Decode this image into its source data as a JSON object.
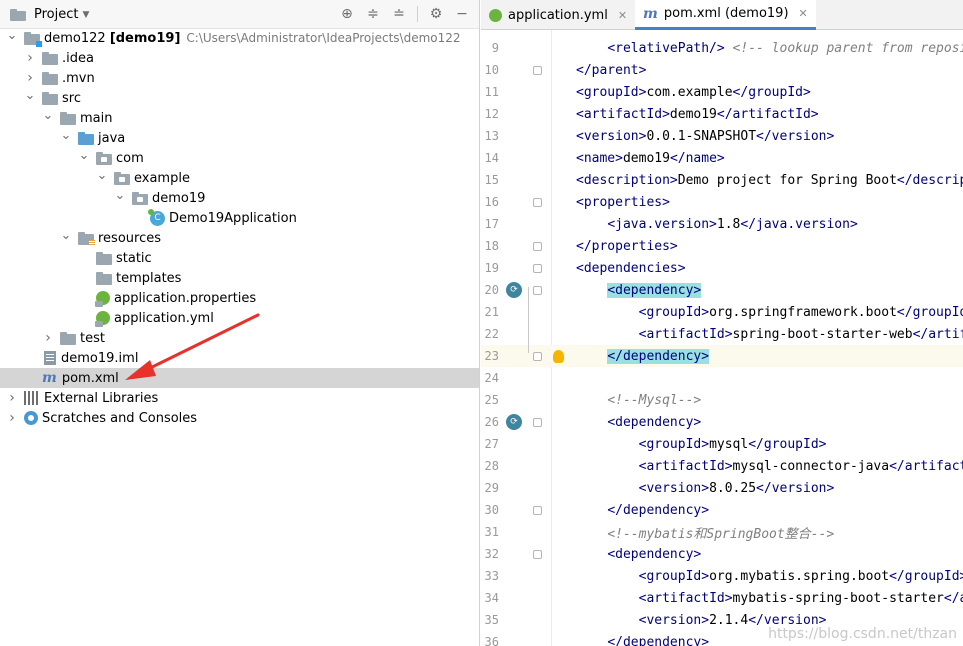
{
  "project_panel": {
    "title": "Project",
    "header_icons": [
      "crosshair-icon",
      "expand-all-icon",
      "collapse-all-icon",
      "gear-icon",
      "minimize-icon"
    ],
    "tree": [
      {
        "label": "demo122 [demo19]",
        "path": "C:\\Users\\Administrator\\IdeaProjects\\demo122",
        "indent": 0,
        "expanded": true,
        "icon": "module-folder"
      },
      {
        "label": ".idea",
        "indent": 1,
        "expanded": false,
        "icon": "folder"
      },
      {
        "label": ".mvn",
        "indent": 1,
        "expanded": false,
        "icon": "folder"
      },
      {
        "label": "src",
        "indent": 1,
        "expanded": true,
        "icon": "folder"
      },
      {
        "label": "main",
        "indent": 2,
        "expanded": true,
        "icon": "folder"
      },
      {
        "label": "java",
        "indent": 3,
        "expanded": true,
        "icon": "source-folder"
      },
      {
        "label": "com",
        "indent": 4,
        "expanded": true,
        "icon": "package"
      },
      {
        "label": "example",
        "indent": 5,
        "expanded": true,
        "icon": "package"
      },
      {
        "label": "demo19",
        "indent": 6,
        "expanded": true,
        "icon": "package"
      },
      {
        "label": "Demo19Application",
        "indent": 7,
        "icon": "class"
      },
      {
        "label": "resources",
        "indent": 3,
        "expanded": true,
        "icon": "resources-folder"
      },
      {
        "label": "static",
        "indent": 4,
        "icon": "folder"
      },
      {
        "label": "templates",
        "indent": 4,
        "icon": "folder"
      },
      {
        "label": "application.properties",
        "indent": 4,
        "icon": "spring-config"
      },
      {
        "label": "application.yml",
        "indent": 4,
        "icon": "spring-config"
      },
      {
        "label": "test",
        "indent": 2,
        "expanded": false,
        "icon": "folder"
      },
      {
        "label": "demo19.iml",
        "indent": 1,
        "icon": "iml-file"
      },
      {
        "label": "pom.xml",
        "indent": 1,
        "icon": "maven-file",
        "selected": true
      },
      {
        "label": "External Libraries",
        "indent": 0,
        "expanded": false,
        "icon": "libraries"
      },
      {
        "label": "Scratches and Consoles",
        "indent": 0,
        "expanded": false,
        "icon": "scratches"
      }
    ]
  },
  "editor": {
    "tabs": [
      {
        "label": "application.yml",
        "active": false,
        "icon": "spring-config"
      },
      {
        "label": "pom.xml (demo19)",
        "active": true,
        "icon": "maven-file"
      }
    ],
    "lines": [
      {
        "n": "9",
        "html": "    <span class=\"t\">&lt;relativePath/&gt;</span> <span class=\"c\">&lt;!-- lookup parent from repository --&gt;</span>"
      },
      {
        "n": "10",
        "html": "<span class=\"t\">&lt;/parent&gt;</span>",
        "fold": true
      },
      {
        "n": "11",
        "html": "<span class=\"t\">&lt;groupId&gt;</span>com.example<span class=\"t\">&lt;/groupId&gt;</span>"
      },
      {
        "n": "12",
        "html": "<span class=\"t\">&lt;artifactId&gt;</span>demo19<span class=\"t\">&lt;/artifactId&gt;</span>"
      },
      {
        "n": "13",
        "html": "<span class=\"t\">&lt;version&gt;</span>0.0.1-SNAPSHOT<span class=\"t\">&lt;/version&gt;</span>"
      },
      {
        "n": "14",
        "html": "<span class=\"t\">&lt;name&gt;</span>demo19<span class=\"t\">&lt;/name&gt;</span>"
      },
      {
        "n": "15",
        "html": "<span class=\"t\">&lt;description&gt;</span>Demo project for Spring Boot<span class=\"t\">&lt;/description&gt;</span>"
      },
      {
        "n": "16",
        "html": "<span class=\"t\">&lt;properties&gt;</span>",
        "fold": true
      },
      {
        "n": "17",
        "html": "    <span class=\"t\">&lt;java.version&gt;</span>1.8<span class=\"t\">&lt;/java.version&gt;</span>"
      },
      {
        "n": "18",
        "html": "<span class=\"t\">&lt;/properties&gt;</span>",
        "fold": true
      },
      {
        "n": "19",
        "html": "<span class=\"t\">&lt;dependencies&gt;</span>",
        "fold": true
      },
      {
        "n": "20",
        "html": "    <span class=\"t hl\">&lt;dependency&gt;</span>",
        "fold": true,
        "run": true
      },
      {
        "n": "21",
        "html": "        <span class=\"t\">&lt;groupId&gt;</span>org.springframework.boot<span class=\"t\">&lt;/groupId&gt;</span>"
      },
      {
        "n": "22",
        "html": "        <span class=\"t\">&lt;artifactId&gt;</span>spring-boot-starter-web<span class=\"t\">&lt;/artifactId&gt;</span>"
      },
      {
        "n": "23",
        "html": "    <span class=\"t hl\">&lt;/dependency&gt;</span>",
        "fold": true,
        "bulb": true,
        "caret": true
      },
      {
        "n": "24",
        "html": ""
      },
      {
        "n": "25",
        "html": "    <span class=\"c\">&lt;!--Mysql--&gt;</span>"
      },
      {
        "n": "26",
        "html": "    <span class=\"t\">&lt;dependency&gt;</span>",
        "fold": true,
        "run": true
      },
      {
        "n": "27",
        "html": "        <span class=\"t\">&lt;groupId&gt;</span>mysql<span class=\"t\">&lt;/groupId&gt;</span>"
      },
      {
        "n": "28",
        "html": "        <span class=\"t\">&lt;artifactId&gt;</span>mysql-connector-java<span class=\"t\">&lt;/artifactId&gt;</span>"
      },
      {
        "n": "29",
        "html": "        <span class=\"t\">&lt;version&gt;</span>8.0.25<span class=\"t\">&lt;/version&gt;</span>"
      },
      {
        "n": "30",
        "html": "    <span class=\"t\">&lt;/dependency&gt;</span>",
        "fold": true
      },
      {
        "n": "31",
        "html": "    <span class=\"c\">&lt;!--mybatis和SpringBoot整合--&gt;</span>"
      },
      {
        "n": "32",
        "html": "    <span class=\"t\">&lt;dependency&gt;</span>",
        "fold": true
      },
      {
        "n": "33",
        "html": "        <span class=\"t\">&lt;groupId&gt;</span>org.mybatis.spring.boot<span class=\"t\">&lt;/groupId&gt;</span>"
      },
      {
        "n": "34",
        "html": "        <span class=\"t\">&lt;artifactId&gt;</span>mybatis-spring-boot-starter<span class=\"t\">&lt;/artifactId&gt;</span>"
      },
      {
        "n": "35",
        "html": "        <span class=\"t\">&lt;version&gt;</span>2.1.4<span class=\"t\">&lt;/version&gt;</span>"
      },
      {
        "n": "36",
        "html": "    <span class=\"t\">&lt;/dependency&gt;</span>"
      }
    ]
  },
  "watermark": "https://blog.csdn.net/thzan"
}
